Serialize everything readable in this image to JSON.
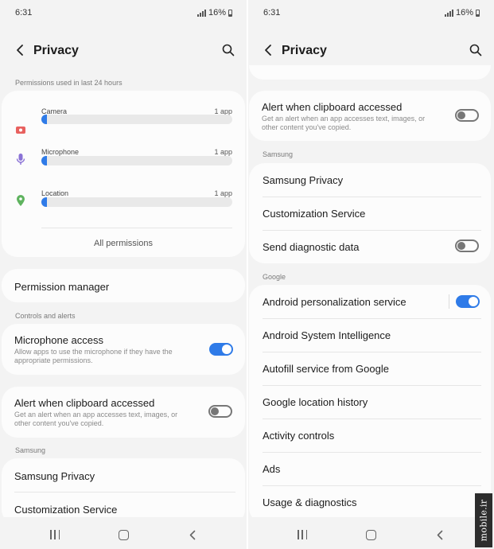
{
  "colors": {
    "accent": "#2f7be8",
    "background": "#f3f3f3",
    "card": "#fcfcfc"
  },
  "left": {
    "status": {
      "time": "6:31",
      "battery": "16%"
    },
    "header": {
      "title": "Privacy",
      "back_icon": "back-arrow-icon",
      "search_icon": "search-icon"
    },
    "permissions_section": "Permissions used in last 24 hours",
    "permissions": [
      {
        "label": "Camera",
        "count": "1 app",
        "icon": "camera-icon",
        "color": "#e8615f",
        "usage": 1
      },
      {
        "label": "Microphone",
        "count": "1 app",
        "icon": "microphone-icon",
        "color": "#8a72d6",
        "usage": 1
      },
      {
        "label": "Location",
        "count": "1 app",
        "icon": "location-icon",
        "color": "#5fb35f",
        "usage": 1
      }
    ],
    "all_permissions": "All permissions",
    "permission_manager": "Permission manager",
    "controls_section": "Controls and alerts",
    "microphone_access": {
      "title": "Microphone access",
      "subtitle": "Allow apps to use the microphone if they have the appropriate permissions.",
      "enabled": true
    },
    "clipboard": {
      "title": "Alert when clipboard accessed",
      "subtitle": "Get an alert when an app accesses text, images, or other content you've copied.",
      "enabled": false
    },
    "samsung_section": "Samsung",
    "samsung_items": [
      "Samsung Privacy",
      "Customization Service"
    ]
  },
  "right": {
    "status": {
      "time": "6:31",
      "battery": "16%"
    },
    "header": {
      "title": "Privacy",
      "back_icon": "back-arrow-icon",
      "search_icon": "search-icon"
    },
    "clipboard": {
      "title": "Alert when clipboard accessed",
      "subtitle": "Get an alert when an app accesses text, images, or other content you've copied.",
      "enabled": false
    },
    "samsung_section": "Samsung",
    "samsung_items": [
      "Samsung Privacy",
      "Customization Service"
    ],
    "send_diagnostic": {
      "title": "Send diagnostic data",
      "enabled": false
    },
    "google_section": "Google",
    "android_personalization": {
      "title": "Android personalization service",
      "enabled": true
    },
    "google_items": [
      "Android System Intelligence",
      "Autofill service from Google",
      "Google location history",
      "Activity controls",
      "Ads",
      "Usage & diagnostics"
    ]
  },
  "watermark": "mobile.ir"
}
